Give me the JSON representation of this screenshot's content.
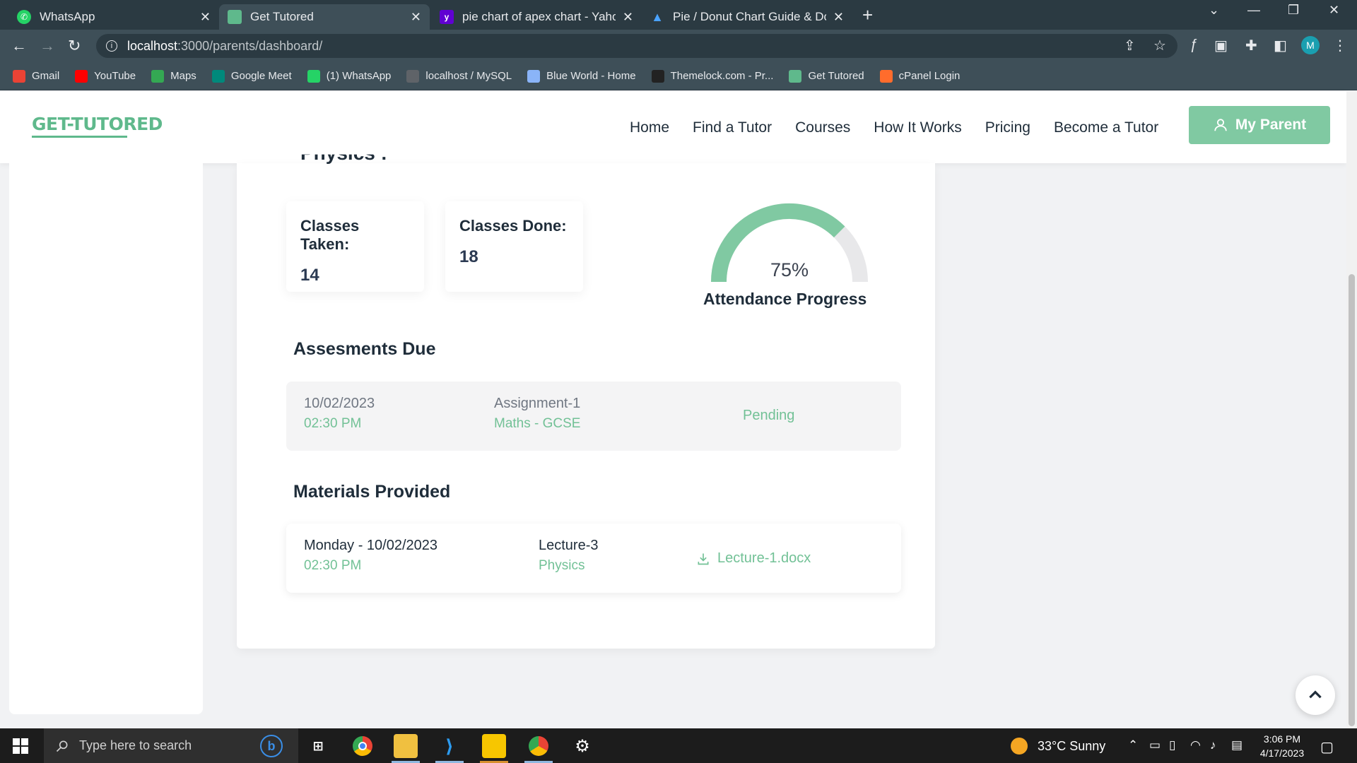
{
  "browser": {
    "tabs": [
      {
        "title": "WhatsApp",
        "icon": "whatsapp-icon",
        "color": "#25d366"
      },
      {
        "title": "Get Tutored",
        "icon": "page-icon",
        "color": "#5fb98c",
        "active": true
      },
      {
        "title": "pie chart of apex chart - Yahoo S",
        "icon": "yahoo-icon",
        "color": "#6001d2"
      },
      {
        "title": "Pie / Donut Chart Guide & Docur",
        "icon": "apexcharts-icon",
        "color": "#1e7ad6"
      }
    ],
    "url_host": "localhost",
    "url_path": ":3000/parents/dashboard/",
    "profile_initial": "M",
    "bookmarks": [
      {
        "label": "Gmail",
        "icon": "gmail-icon",
        "color": "#ea4335"
      },
      {
        "label": "YouTube",
        "icon": "youtube-icon",
        "color": "#ff0000"
      },
      {
        "label": "Maps",
        "icon": "maps-icon",
        "color": "#34a853"
      },
      {
        "label": "Google Meet",
        "icon": "meet-icon",
        "color": "#00897b"
      },
      {
        "label": "(1) WhatsApp",
        "icon": "whatsapp-icon",
        "color": "#25d366"
      },
      {
        "label": "localhost / MySQL",
        "icon": "globe-icon",
        "color": "#5f6368"
      },
      {
        "label": "Blue World - Home",
        "icon": "layers-icon",
        "color": "#8ab4f8"
      },
      {
        "label": "Themelock.com - Pr...",
        "icon": "themelock-icon",
        "color": "#222222"
      },
      {
        "label": "Get Tutored",
        "icon": "page-icon",
        "color": "#5fb98c"
      },
      {
        "label": "cPanel Login",
        "icon": "cpanel-icon",
        "color": "#ff6c2c"
      }
    ]
  },
  "site": {
    "logo": "GET-TUTORED",
    "nav": [
      "Home",
      "Find a Tutor",
      "Courses",
      "How It Works",
      "Pricing",
      "Become a Tutor"
    ],
    "cta": "My Parent",
    "accent": "#80c9a2"
  },
  "dashboard": {
    "cut_title": "Physics :",
    "stats": [
      {
        "label": "Classes Taken:",
        "value": "14"
      },
      {
        "label": "Classes Done:",
        "value": "18"
      }
    ],
    "attendance": {
      "percent_label": "75%",
      "fraction": 0.75,
      "label": "Attendance Progress"
    },
    "assessments_title": "Assesments Due",
    "assessment": {
      "date": "10/02/2023",
      "time": "02:30 PM",
      "name": "Assignment-1",
      "subject": "Maths - GCSE",
      "status": "Pending"
    },
    "materials_title": "Materials Provided",
    "material": {
      "date": "Monday - 10/02/2023",
      "time": "02:30 PM",
      "name": "Lecture-3",
      "subject": "Physics",
      "file": "Lecture-1.docx"
    }
  },
  "taskbar": {
    "search_placeholder": "Type here to search",
    "weather": "33°C  Sunny",
    "time": "3:06 PM",
    "date": "4/17/2023"
  }
}
